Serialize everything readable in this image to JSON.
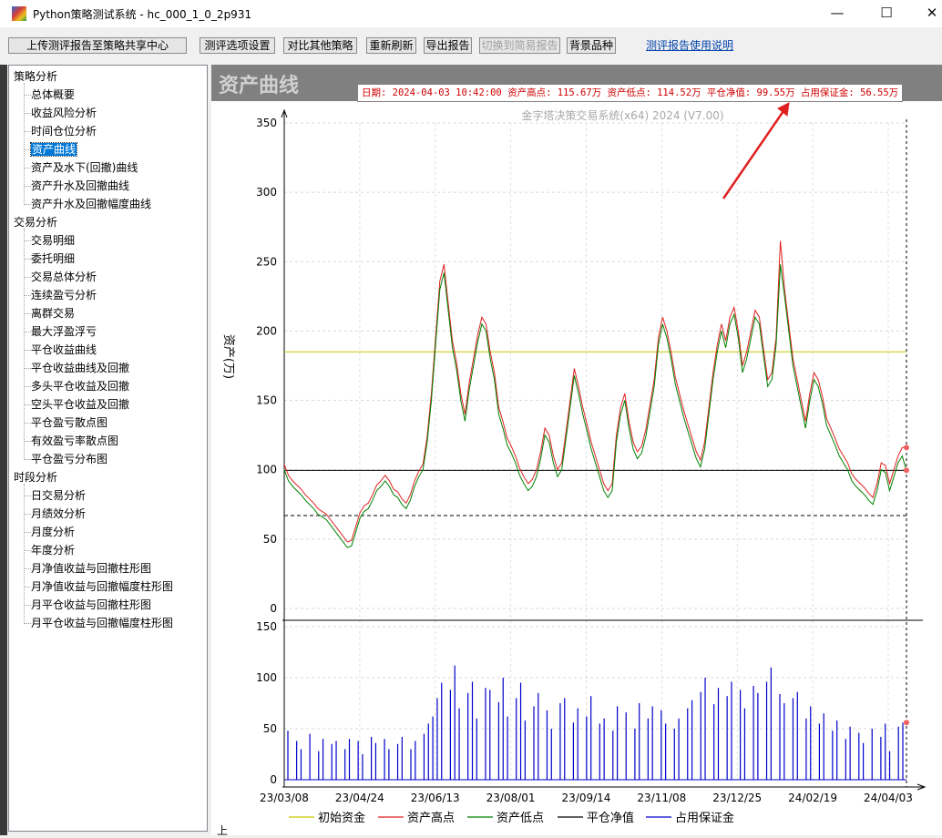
{
  "window": {
    "title": "Python策略测试系统 - hc_000_1_0_2p931",
    "minimize_glyph": "—",
    "maximize_glyph": "☐",
    "close_glyph": "✕",
    "icon": "colorful-app-icon"
  },
  "toolbar": {
    "upload": "上传测评报告至策略共享中心",
    "options": "测评选项设置",
    "compare": "对比其他策略",
    "refresh": "重新刷新",
    "export": "导出报告",
    "switch_simple": "切换到简易报告",
    "background": "背景品种",
    "help_link": "测评报告使用说明"
  },
  "tree": {
    "groups": [
      {
        "label": "策略分析",
        "items": [
          "总体概要",
          "收益风险分析",
          "时间仓位分析",
          "资产曲线",
          "资产及水下(回撤)曲线",
          "资产升水及回撤曲线",
          "资产升水及回撤幅度曲线"
        ]
      },
      {
        "label": "交易分析",
        "items": [
          "交易明细",
          "委托明细",
          "交易总体分析",
          "连续盈亏分析",
          "离群交易",
          "最大浮盈浮亏",
          "平仓收益曲线",
          "平仓收益曲线及回撤",
          "多头平仓收益及回撤",
          "空头平仓收益及回撤",
          "平仓盈亏散点图",
          "有效盈亏率散点图",
          "平仓盈亏分布图"
        ]
      },
      {
        "label": "时段分析",
        "items": [
          "日交易分析",
          "月绩效分析",
          "月度分析",
          "年度分析",
          "月净值收益与回撤柱形图",
          "月净值收益与回撤幅度柱形图",
          "月平仓收益与回撤柱形图",
          "月平仓收益与回撤幅度柱形图"
        ]
      }
    ],
    "selected": "资产曲线"
  },
  "panel": {
    "title": "资产曲线",
    "info": "日期: 2024-04-03 10:42:00  资产高点: 115.67万  资产低点: 114.52万  平仓净值: 99.55万  占用保证金: 56.55万",
    "watermark": "金字塔决策交易系统(x64) 2024 (V7.00)",
    "bottom_mark": "上"
  },
  "colors": {
    "init": "#c8c800",
    "high": "#e02020",
    "low": "#008000",
    "net": "#000000",
    "margin": "#0000cc",
    "arrow": "#e02020"
  },
  "chart_data": [
    {
      "type": "line",
      "ylabel": "资产(万)",
      "ylim": [
        0,
        350
      ],
      "yticks": [
        0,
        50,
        100,
        150,
        200,
        250,
        300,
        350
      ],
      "xtick_labels": [
        "23/03/08",
        "23/04/24",
        "23/06/13",
        "23/08/01",
        "23/09/14",
        "23/11/08",
        "23/12/25",
        "24/02/19",
        "24/04/03"
      ],
      "hlines": {
        "init_capital": 185,
        "net_value": 99.55,
        "dashed_min": 67
      },
      "series": [
        {
          "name": "资产低点",
          "key": "low",
          "values": [
            100,
            92,
            88,
            85,
            82,
            78,
            75,
            72,
            68,
            66,
            64,
            60,
            56,
            52,
            48,
            44,
            45,
            55,
            65,
            70,
            72,
            78,
            85,
            88,
            92,
            88,
            82,
            80,
            75,
            72,
            78,
            88,
            95,
            100,
            120,
            150,
            190,
            230,
            242,
            215,
            188,
            172,
            150,
            135,
            158,
            175,
            192,
            205,
            200,
            180,
            165,
            140,
            130,
            118,
            112,
            105,
            96,
            90,
            85,
            88,
            95,
            108,
            125,
            120,
            105,
            95,
            100,
            122,
            145,
            168,
            155,
            140,
            128,
            115,
            105,
            95,
            85,
            80,
            85,
            120,
            140,
            150,
            130,
            115,
            108,
            112,
            124,
            142,
            160,
            190,
            205,
            195,
            180,
            162,
            150,
            138,
            128,
            118,
            108,
            102,
            115,
            140,
            165,
            185,
            200,
            188,
            205,
            212,
            195,
            170,
            180,
            195,
            210,
            205,
            182,
            160,
            165,
            190,
            248,
            225,
            200,
            175,
            160,
            145,
            130,
            150,
            165,
            160,
            148,
            132,
            125,
            118,
            110,
            105,
            100,
            92,
            88,
            85,
            82,
            78,
            75,
            85,
            100,
            98,
            85,
            95,
            105,
            110,
            99
          ]
        },
        {
          "name": "资产高点",
          "key": "high",
          "values": [
            104,
            96,
            92,
            89,
            86,
            82,
            79,
            76,
            72,
            70,
            68,
            64,
            60,
            56,
            52,
            48,
            49,
            59,
            69,
            74,
            76,
            82,
            89,
            92,
            96,
            92,
            86,
            84,
            79,
            76,
            82,
            92,
            99,
            104,
            124,
            155,
            195,
            236,
            248,
            220,
            193,
            177,
            155,
            140,
            163,
            180,
            197,
            210,
            205,
            185,
            170,
            145,
            135,
            123,
            117,
            110,
            101,
            95,
            90,
            93,
            100,
            113,
            130,
            125,
            110,
            100,
            105,
            127,
            150,
            173,
            160,
            145,
            133,
            120,
            110,
            100,
            90,
            85,
            90,
            125,
            145,
            155,
            135,
            120,
            113,
            117,
            129,
            147,
            165,
            195,
            210,
            200,
            185,
            167,
            155,
            143,
            133,
            123,
            113,
            107,
            120,
            145,
            170,
            190,
            205,
            193,
            210,
            217,
            200,
            175,
            185,
            200,
            215,
            210,
            187,
            165,
            170,
            195,
            265,
            230,
            205,
            180,
            165,
            150,
            135,
            155,
            170,
            165,
            153,
            137,
            130,
            123,
            115,
            110,
            105,
            97,
            93,
            90,
            87,
            83,
            80,
            90,
            105,
            103,
            90,
            100,
            110,
            116,
            116
          ]
        }
      ]
    },
    {
      "type": "bar",
      "ylabel": "",
      "ylim": [
        0,
        150
      ],
      "yticks": [
        0,
        50,
        100,
        150
      ],
      "series": [
        {
          "name": "占用保证金",
          "key": "margin",
          "values": [
            48,
            0,
            38,
            30,
            0,
            45,
            0,
            28,
            40,
            0,
            35,
            38,
            0,
            30,
            40,
            0,
            38,
            25,
            0,
            42,
            36,
            0,
            40,
            30,
            0,
            35,
            42,
            0,
            30,
            38,
            0,
            45,
            55,
            62,
            80,
            95,
            0,
            88,
            112,
            70,
            0,
            85,
            96,
            60,
            0,
            90,
            88,
            0,
            76,
            100,
            62,
            0,
            80,
            95,
            58,
            0,
            72,
            85,
            0,
            68,
            50,
            0,
            75,
            80,
            0,
            56,
            70,
            0,
            62,
            82,
            0,
            55,
            60,
            0,
            48,
            72,
            0,
            66,
            0,
            50,
            75,
            0,
            60,
            72,
            0,
            68,
            55,
            0,
            50,
            60,
            0,
            70,
            78,
            0,
            86,
            100,
            0,
            74,
            90,
            0,
            82,
            96,
            0,
            88,
            70,
            0,
            92,
            85,
            0,
            96,
            110,
            0,
            84,
            75,
            0,
            80,
            86,
            0,
            60,
            72,
            0,
            55,
            65,
            0,
            48,
            58,
            0,
            40,
            52,
            0,
            46,
            36,
            0,
            50,
            0,
            42,
            55,
            28,
            0,
            52,
            56
          ]
        }
      ]
    }
  ],
  "legend": [
    {
      "label": "初始资金",
      "key": "init"
    },
    {
      "label": "资产高点",
      "key": "high"
    },
    {
      "label": "资产低点",
      "key": "low"
    },
    {
      "label": "平仓净值",
      "key": "net"
    },
    {
      "label": "占用保证金",
      "key": "margin"
    }
  ]
}
